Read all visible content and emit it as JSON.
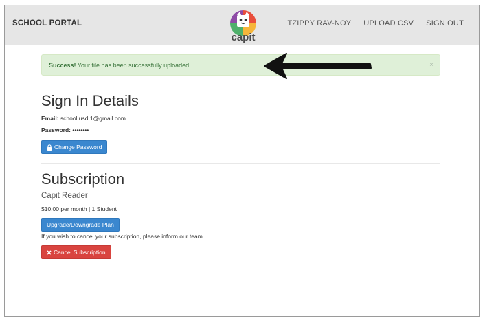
{
  "navbar": {
    "brand": "SCHOOL PORTAL",
    "logo_text": "capit",
    "links": [
      "TZIPPY RAV-NOY",
      "UPLOAD CSV",
      "SIGN OUT"
    ]
  },
  "alert": {
    "strong": "Success!",
    "message": " Your file has been successfully uploaded.",
    "close": "×"
  },
  "sign_in": {
    "title": "Sign In Details",
    "email_label": "Email:",
    "email_value": " school.usd.1@gmail.com",
    "password_label": "Password:",
    "password_value": " ••••••••",
    "change_password_button": "Change Password"
  },
  "subscription": {
    "title": "Subscription",
    "plan_name": "Capit Reader",
    "price": "$10.00 per month | 1 Student",
    "upgrade_button": "Upgrade/Downgrade Plan",
    "cancel_note": "If you wish to cancel your subscription, please inform our team",
    "cancel_button": "Cancel Subscription"
  },
  "colors": {
    "navbar_bg": "#e6e6e6",
    "success_bg": "#dff0d8",
    "success_text": "#3c763d",
    "primary": "#3a87cf",
    "danger": "#d9443f"
  },
  "icons": [
    "capit-logo-icon",
    "arrow-annotation-icon",
    "lock-icon",
    "close-x-icon"
  ]
}
